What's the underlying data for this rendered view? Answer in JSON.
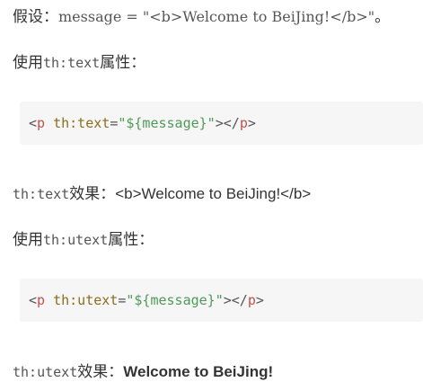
{
  "assume": {
    "label": "假设：",
    "code": "message = \"<b>Welcome to BeiJing!</b>\"",
    "end": "。"
  },
  "text_attr": {
    "prefix": "使用",
    "attr": "th:text",
    "suffix": "属性："
  },
  "code_text": {
    "open_bracket": "<",
    "tag": "p",
    "attr": "th:text",
    "equals": "=",
    "value": "\"${message}\"",
    "close": "></",
    "end_tag": "p",
    "end_bracket": ">"
  },
  "text_result": {
    "attr": "th:text",
    "label": "效果：",
    "value": "<b>Welcome to BeiJing!</b>"
  },
  "utext_attr": {
    "prefix": "使用",
    "attr": "th:utext",
    "suffix": "属性："
  },
  "code_utext": {
    "open_bracket": "<",
    "tag": "p",
    "attr": "th:utext",
    "equals": "=",
    "value": "\"${message}\"",
    "close": "></",
    "end_tag": "p",
    "end_bracket": ">"
  },
  "utext_result": {
    "attr": "th:utext",
    "label": "效果：",
    "value": "Welcome to BeiJing!"
  }
}
